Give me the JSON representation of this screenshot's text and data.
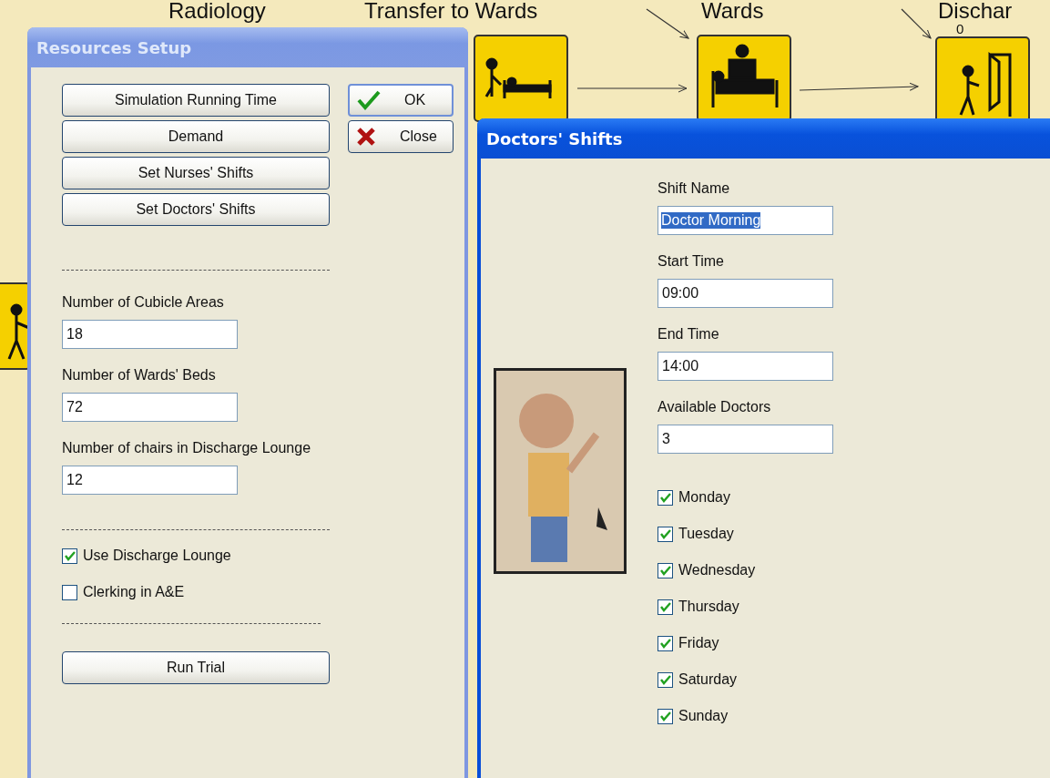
{
  "canvas": {
    "labels": [
      {
        "text": "Radiology",
        "kind": "title"
      },
      {
        "text": "Transfer to Wards",
        "kind": "title"
      },
      {
        "text": "Wards",
        "kind": "title"
      },
      {
        "text": "Dischar",
        "kind": "title"
      },
      {
        "text": "0",
        "kind": "count"
      }
    ],
    "nodes": [
      {
        "kind": "bed"
      },
      {
        "kind": "nurse-bed"
      },
      {
        "kind": "exit"
      },
      {
        "kind": "walker"
      }
    ]
  },
  "resources_setup": {
    "title": "Resources Setup",
    "nav_buttons": [
      "Simulation Running Time",
      "Demand",
      "Set Nurses' Shifts",
      "Set Doctors' Shifts"
    ],
    "ok_button": "OK",
    "close_button": "Close",
    "fields": [
      {
        "label": "Number of Cubicle Areas",
        "value": "18"
      },
      {
        "label": "Number of Wards' Beds",
        "value": "72"
      },
      {
        "label": "Number of chairs in Discharge Lounge",
        "value": "12"
      }
    ],
    "checkboxes": [
      {
        "label": "Use Discharge Lounge",
        "checked": true
      },
      {
        "label": "Clerking in A&E",
        "checked": false
      }
    ],
    "run_button": "Run Trial"
  },
  "doctors_shifts": {
    "title": "Doctors' Shifts",
    "fields": [
      {
        "label": "Shift Name",
        "value": "Doctor Morning",
        "selected": true
      },
      {
        "label": "Start Time",
        "value": "09:00",
        "selected": false
      },
      {
        "label": "End Time",
        "value": "14:00",
        "selected": false
      },
      {
        "label": "Available Doctors",
        "value": "3",
        "selected": false
      }
    ],
    "days": [
      {
        "label": "Monday",
        "checked": true
      },
      {
        "label": "Tuesday",
        "checked": true
      },
      {
        "label": "Wednesday",
        "checked": true
      },
      {
        "label": "Thursday",
        "checked": true
      },
      {
        "label": "Friday",
        "checked": true
      },
      {
        "label": "Saturday",
        "checked": true
      },
      {
        "label": "Sunday",
        "checked": true
      }
    ]
  }
}
